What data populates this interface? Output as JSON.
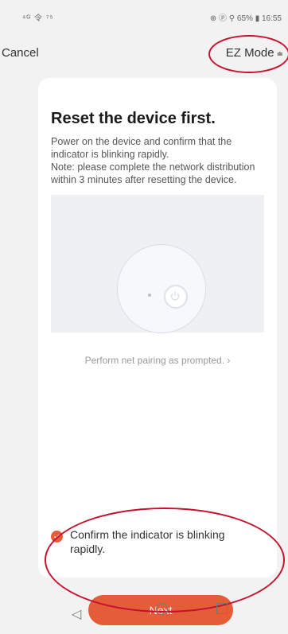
{
  "status_bar": {
    "left": "⁴ᴳ 令 ⁷⁵",
    "right": "⊕ ⓟ ⚲ 65% ▮ 16:55"
  },
  "header": {
    "cancel_label": "Cancel",
    "mode_label": "EZ Mode",
    "mode_caret": "≐"
  },
  "card": {
    "title": "Reset the device first.",
    "instructions": [
      "Power on the device and confirm that the indicator is blinking rapidly.",
      "Note: please complete the network distribution within 3 minutes after resetting the device."
    ],
    "help_link": "Perform net pairing as prompted. ›",
    "confirm_text": "Confirm the indicator is blinking rapidly.",
    "confirm_checked": true,
    "next_label": "Next"
  },
  "colors": {
    "accent": "#e45c38",
    "annotation": "#c8102e"
  },
  "icons": {
    "check": "check-icon",
    "back": "back-triangle-icon",
    "home": "home-circle-icon",
    "recent": "recent-apps-square-icon",
    "power": "power-icon"
  },
  "nav_bar": {
    "back_glyph": "◁"
  }
}
